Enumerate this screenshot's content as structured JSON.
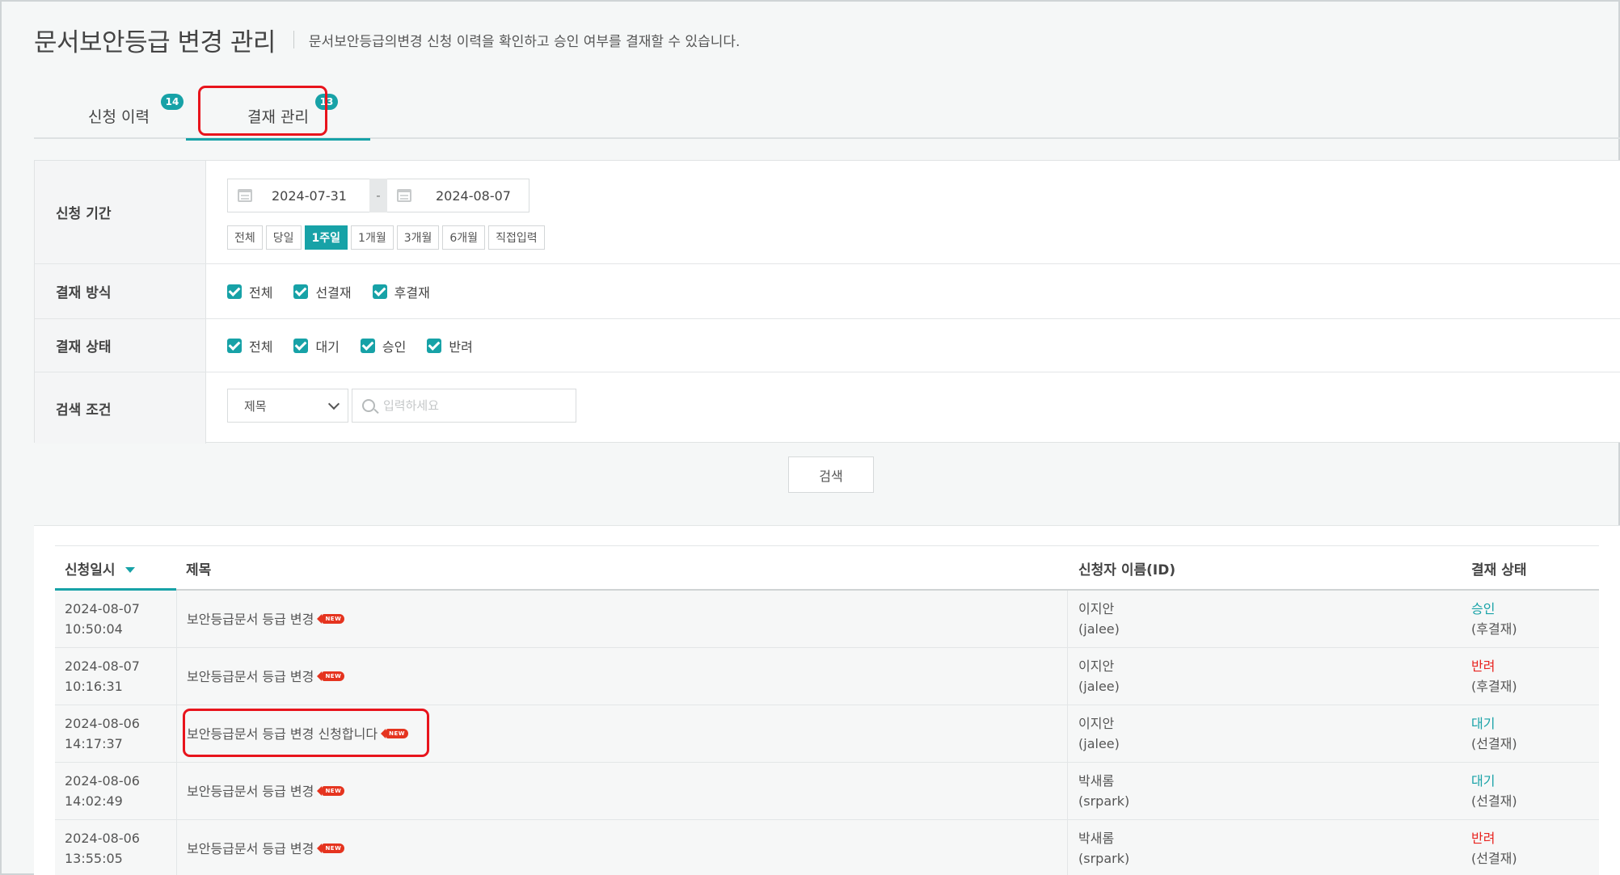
{
  "header": {
    "title": "문서보안등급 변경 관리",
    "description": "문서보안등급의변경 신청 이력을 확인하고 승인 여부를 결재할 수 있습니다."
  },
  "tabs": [
    {
      "label": "신청 이력",
      "count": "14"
    },
    {
      "label": "결재 관리",
      "count": "13",
      "active": true
    }
  ],
  "filters": {
    "period_label": "신청 기간",
    "date_from": "2024-07-31",
    "date_to": "2024-08-07",
    "date_separator": "-",
    "period_buttons": [
      "전체",
      "당일",
      "1주일",
      "1개월",
      "3개월",
      "6개월",
      "직접입력"
    ],
    "period_active": "1주일",
    "method_label": "결재 방식",
    "method_options": [
      "전체",
      "선결재",
      "후결재"
    ],
    "status_label": "결재 상태",
    "status_options": [
      "전체",
      "대기",
      "승인",
      "반려"
    ],
    "search_label": "검색 조건",
    "search_field": "제목",
    "search_placeholder": "입력하세요"
  },
  "search_button": "검색",
  "table": {
    "columns": [
      "신청일시",
      "제목",
      "신청자 이름(ID)",
      "결재 상태"
    ],
    "new_tag": "NEW",
    "rows": [
      {
        "date": "2024-08-07",
        "time": "10:50:04",
        "title": "보안등급문서 등급 변경",
        "name": "이지안",
        "id": "(jalee)",
        "status": "승인",
        "method": "(후결재)"
      },
      {
        "date": "2024-08-07",
        "time": "10:16:31",
        "title": "보안등급문서 등급 변경",
        "name": "이지안",
        "id": "(jalee)",
        "status": "반려",
        "method": "(후결재)"
      },
      {
        "date": "2024-08-06",
        "time": "14:17:37",
        "title": "보안등급문서 등급 변경 신청합니다",
        "name": "이지안",
        "id": "(jalee)",
        "status": "대기",
        "method": "(선결재)"
      },
      {
        "date": "2024-08-06",
        "time": "14:02:49",
        "title": "보안등급문서 등급 변경",
        "name": "박새롬",
        "id": "(srpark)",
        "status": "대기",
        "method": "(선결재)"
      },
      {
        "date": "2024-08-06",
        "time": "13:55:05",
        "title": "보안등급문서 등급 변경",
        "name": "박새롬",
        "id": "(srpark)",
        "status": "반려",
        "method": "(선결재)"
      }
    ]
  },
  "colors": {
    "accent": "#17a2a7",
    "rejected": "#e8231f",
    "highlight": "#e8141c"
  }
}
